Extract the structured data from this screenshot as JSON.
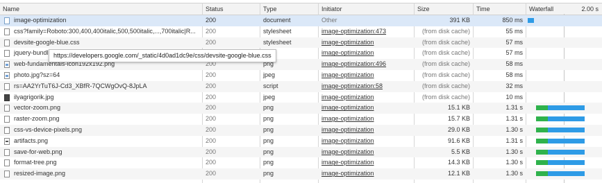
{
  "columns": {
    "name": "Name",
    "status": "Status",
    "type": "Type",
    "initiator": "Initiator",
    "size": "Size",
    "time": "Time",
    "waterfall": "Waterfall",
    "waterfall_scale": "2.00 s"
  },
  "tooltip": "https://developers.google.com/_static/4d0ad1dc9e/css/devsite-google-blue.css",
  "rows": [
    {
      "name": "image-optimization",
      "status": "200",
      "type": "document",
      "initiator": "Other",
      "size": "391 KB",
      "time": "850 ms",
      "icon": "document-icon"
    },
    {
      "name": "css?family=Roboto:300,400,400italic,500,500italic,...,700italic|R...",
      "status": "200",
      "type": "stylesheet",
      "initiator": "image-optimization:473",
      "size": "(from disk cache)",
      "time": "55 ms",
      "icon": "file-icon"
    },
    {
      "name": "devsite-google-blue.css",
      "status": "200",
      "type": "stylesheet",
      "initiator": "image-optimization",
      "size": "(from disk cache)",
      "time": "57 ms",
      "icon": "file-icon"
    },
    {
      "name": "jquery-bundl",
      "status": "200",
      "type": "",
      "initiator": "image-optimization",
      "size": "(from disk cache)",
      "time": "57 ms",
      "icon": "file-icon"
    },
    {
      "name": "web-fundamentals-icon192x192.png",
      "status": "200",
      "type": "png",
      "initiator": "image-optimization:496",
      "size": "(from disk cache)",
      "time": "58 ms",
      "icon": "image-icon"
    },
    {
      "name": "photo.jpg?sz=64",
      "status": "200",
      "type": "jpeg",
      "initiator": "image-optimization",
      "size": "(from disk cache)",
      "time": "58 ms",
      "icon": "image-icon"
    },
    {
      "name": "rs=AA2YrTuT6J-Cd3_XBfR-7QCWgOvQ-8JpLA",
      "status": "200",
      "type": "script",
      "initiator": "image-optimization:58",
      "size": "(from disk cache)",
      "time": "32 ms",
      "icon": "file-icon"
    },
    {
      "name": "ilyagrigorik.jpg",
      "status": "200",
      "type": "jpeg",
      "initiator": "image-optimization",
      "size": "(from disk cache)",
      "time": "10 ms",
      "icon": "photo-icon"
    },
    {
      "name": "vector-zoom.png",
      "status": "200",
      "type": "png",
      "initiator": "image-optimization",
      "size": "15.1 KB",
      "time": "1.31 s",
      "icon": "image-icon"
    },
    {
      "name": "raster-zoom.png",
      "status": "200",
      "type": "png",
      "initiator": "image-optimization",
      "size": "15.7 KB",
      "time": "1.31 s",
      "icon": "image-icon"
    },
    {
      "name": "css-vs-device-pixels.png",
      "status": "200",
      "type": "png",
      "initiator": "image-optimization",
      "size": "29.0 KB",
      "time": "1.30 s",
      "icon": "image-icon"
    },
    {
      "name": "artifacts.png",
      "status": "200",
      "type": "png",
      "initiator": "image-optimization",
      "size": "91.6 KB",
      "time": "1.31 s",
      "icon": "image-icon"
    },
    {
      "name": "save-for-web.png",
      "status": "200",
      "type": "png",
      "initiator": "image-optimization",
      "size": "5.5 KB",
      "time": "1.30 s",
      "icon": "image-icon"
    },
    {
      "name": "format-tree.png",
      "status": "200",
      "type": "png",
      "initiator": "image-optimization",
      "size": "14.3 KB",
      "time": "1.30 s",
      "icon": "image-icon"
    },
    {
      "name": "resized-image.png",
      "status": "200",
      "type": "png",
      "initiator": "image-optimization",
      "size": "12.1 KB",
      "time": "1.30 s",
      "icon": "image-icon"
    }
  ],
  "colors": {
    "header_bg": "#f3f3f3",
    "selected_row": "#dbe8f8",
    "waterfall_green": "#2fb24c",
    "waterfall_blue": "#2e9be6"
  }
}
